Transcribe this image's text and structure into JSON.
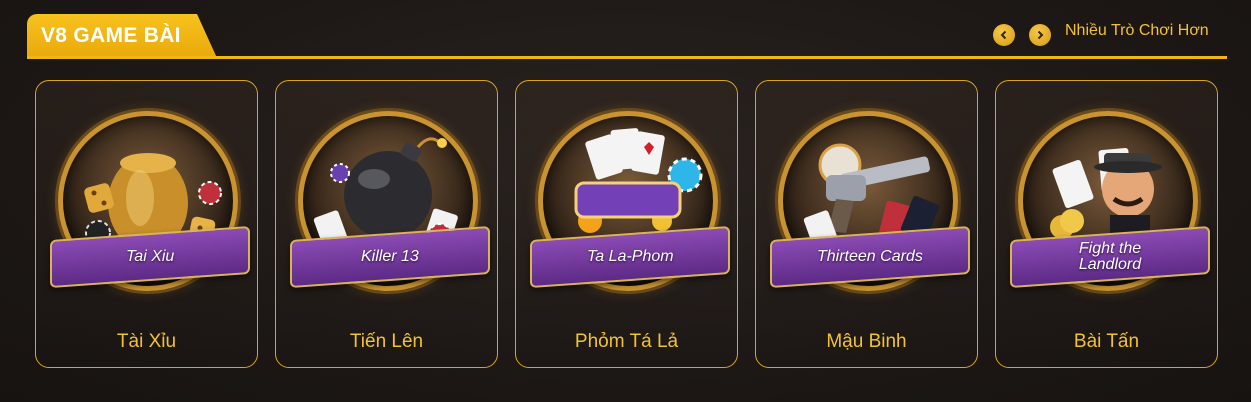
{
  "header": {
    "title": "V8 GAME BÀI",
    "more_label": "Nhiều Trò Chơi Hơn",
    "prev_icon": "chevron-left-icon",
    "next_icon": "chevron-right-icon",
    "accent": "#f1b514"
  },
  "games": [
    {
      "name": "Tài Xỉu",
      "banner": "Tai Xiu",
      "icon": "dice-jar-icon"
    },
    {
      "name": "Tiến Lên",
      "banner": "Killer 13",
      "icon": "bomb-icon"
    },
    {
      "name": "Phỏm Tá Lả",
      "banner": "Ta La-Phom",
      "icon": "phom-cards-icon"
    },
    {
      "name": "Mậu Binh",
      "banner": "Thirteen Cards",
      "icon": "revolver-icon"
    },
    {
      "name": "Bài Tấn",
      "banner": "Fight the Landlord",
      "icon": "landlord-icon"
    }
  ]
}
